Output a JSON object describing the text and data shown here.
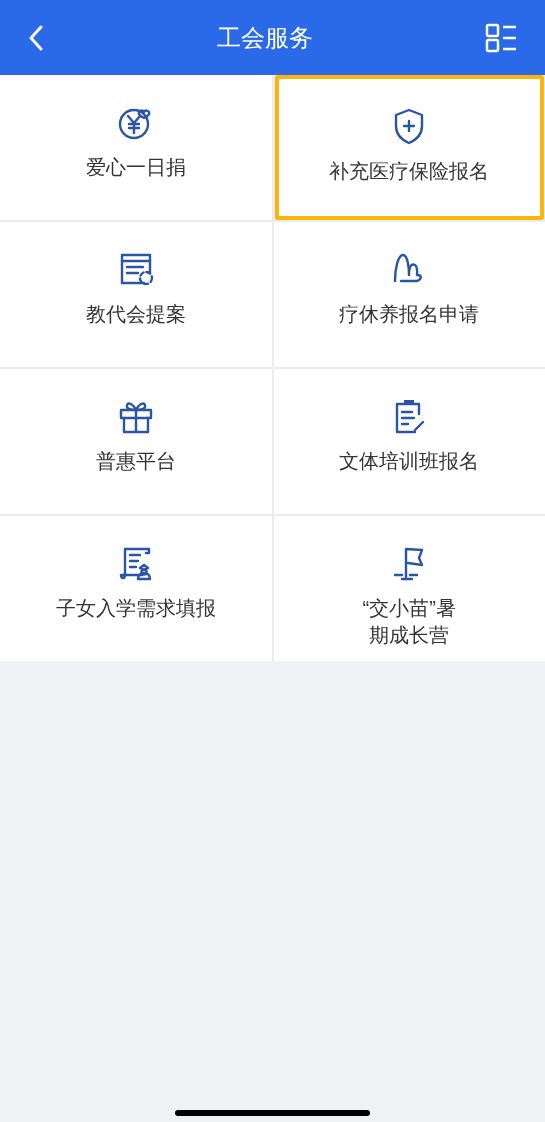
{
  "header": {
    "title": "工会服务"
  },
  "services": [
    {
      "label": "爱心一日捐",
      "kind": "donation",
      "highlighted": false
    },
    {
      "label": "补充医疗保险报名",
      "kind": "shield",
      "highlighted": true
    },
    {
      "label": "教代会提案",
      "kind": "proposal",
      "highlighted": false
    },
    {
      "label": "疗休养报名申请",
      "kind": "mountain",
      "highlighted": false
    },
    {
      "label": "普惠平台",
      "kind": "gift",
      "highlighted": false
    },
    {
      "label": "文体培训班报名",
      "kind": "clipboard",
      "highlighted": false
    },
    {
      "label": "子女入学需求填报",
      "kind": "scroll",
      "highlighted": false
    },
    {
      "label": "“交小苗”暑期成长营",
      "kind": "flag",
      "highlighted": false
    }
  ]
}
